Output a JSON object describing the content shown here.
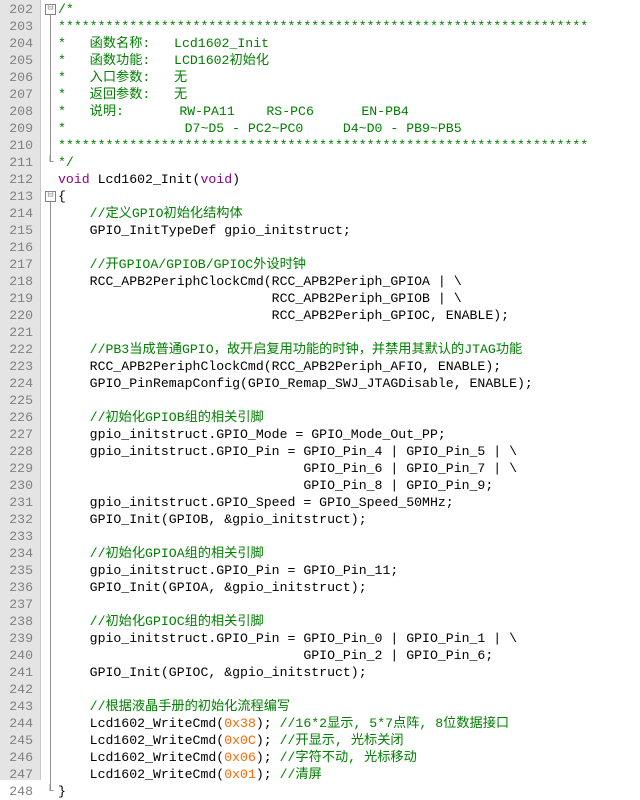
{
  "editor": {
    "colors": {
      "comment": "#008000",
      "keyword": "#8b008b",
      "number": "#ff6600",
      "text": "#000000",
      "gutter": "#e4e4e4"
    },
    "lines": [
      {
        "no": "202",
        "marker": "⊟",
        "segments": [
          {
            "t": "/*",
            "c": "cm"
          }
        ]
      },
      {
        "no": "203",
        "marker": "",
        "segments": [
          {
            "t": "*******************************************************************",
            "c": "cm"
          }
        ]
      },
      {
        "no": "204",
        "marker": "",
        "segments": [
          {
            "t": "*   函数名称:   Lcd1602_Init",
            "c": "cm"
          }
        ]
      },
      {
        "no": "205",
        "marker": "",
        "segments": [
          {
            "t": "*   函数功能:   LCD1602初始化",
            "c": "cm"
          }
        ]
      },
      {
        "no": "206",
        "marker": "",
        "segments": [
          {
            "t": "*   入口参数:   无",
            "c": "cm"
          }
        ]
      },
      {
        "no": "207",
        "marker": "",
        "segments": [
          {
            "t": "*   返回参数:   无",
            "c": "cm"
          }
        ]
      },
      {
        "no": "208",
        "marker": "",
        "segments": [
          {
            "t": "*   说明:       RW-PA11    RS-PC6      EN-PB4",
            "c": "cm"
          }
        ]
      },
      {
        "no": "209",
        "marker": "",
        "segments": [
          {
            "t": "*               D7~D5 - PC2~PC0     D4~D0 - PB9~PB5",
            "c": "cm"
          }
        ]
      },
      {
        "no": "210",
        "marker": "",
        "segments": [
          {
            "t": "*******************************************************************",
            "c": "cm"
          }
        ]
      },
      {
        "no": "211",
        "marker": "└",
        "segments": [
          {
            "t": "*/",
            "c": "cm"
          }
        ]
      },
      {
        "no": "212",
        "marker": "",
        "segments": [
          {
            "t": "void",
            "c": "kw"
          },
          {
            "t": " Lcd1602_Init(",
            "c": ""
          },
          {
            "t": "void",
            "c": "kw"
          },
          {
            "t": ")",
            "c": ""
          }
        ]
      },
      {
        "no": "213",
        "marker": "⊟",
        "segments": [
          {
            "t": "{",
            "c": ""
          }
        ]
      },
      {
        "no": "214",
        "marker": "",
        "segments": [
          {
            "t": "    //定义GPIO初始化结构体",
            "c": "cm"
          }
        ]
      },
      {
        "no": "215",
        "marker": "",
        "segments": [
          {
            "t": "    GPIO_InitTypeDef gpio_initstruct;",
            "c": ""
          }
        ]
      },
      {
        "no": "216",
        "marker": "",
        "segments": [
          {
            "t": "",
            "c": ""
          }
        ]
      },
      {
        "no": "217",
        "marker": "",
        "segments": [
          {
            "t": "    //开GPIOA/GPIOB/GPIOC外设时钟",
            "c": "cm"
          }
        ]
      },
      {
        "no": "218",
        "marker": "",
        "segments": [
          {
            "t": "    RCC_APB2PeriphClockCmd(RCC_APB2Periph_GPIOA | \\",
            "c": ""
          }
        ]
      },
      {
        "no": "219",
        "marker": "",
        "segments": [
          {
            "t": "                           RCC_APB2Periph_GPIOB | \\",
            "c": ""
          }
        ]
      },
      {
        "no": "220",
        "marker": "",
        "segments": [
          {
            "t": "                           RCC_APB2Periph_GPIOC, ENABLE);",
            "c": ""
          }
        ]
      },
      {
        "no": "221",
        "marker": "",
        "segments": [
          {
            "t": "",
            "c": ""
          }
        ]
      },
      {
        "no": "222",
        "marker": "",
        "segments": [
          {
            "t": "    //PB3当成普通GPIO，故开启复用功能的时钟，并禁用其默认的JTAG功能",
            "c": "cm"
          }
        ]
      },
      {
        "no": "223",
        "marker": "",
        "segments": [
          {
            "t": "    RCC_APB2PeriphClockCmd(RCC_APB2Periph_AFIO, ENABLE);",
            "c": ""
          }
        ]
      },
      {
        "no": "224",
        "marker": "",
        "segments": [
          {
            "t": "    GPIO_PinRemapConfig(GPIO_Remap_SWJ_JTAGDisable, ENABLE);",
            "c": ""
          }
        ]
      },
      {
        "no": "225",
        "marker": "",
        "segments": [
          {
            "t": "",
            "c": ""
          }
        ]
      },
      {
        "no": "226",
        "marker": "",
        "segments": [
          {
            "t": "    //初始化GPIOB组的相关引脚",
            "c": "cm"
          }
        ]
      },
      {
        "no": "227",
        "marker": "",
        "segments": [
          {
            "t": "    gpio_initstruct.GPIO_Mode = GPIO_Mode_Out_PP;",
            "c": ""
          }
        ]
      },
      {
        "no": "228",
        "marker": "",
        "segments": [
          {
            "t": "    gpio_initstruct.GPIO_Pin = GPIO_Pin_4 | GPIO_Pin_5 | \\",
            "c": ""
          }
        ]
      },
      {
        "no": "229",
        "marker": "",
        "segments": [
          {
            "t": "                               GPIO_Pin_6 | GPIO_Pin_7 | \\",
            "c": ""
          }
        ]
      },
      {
        "no": "230",
        "marker": "",
        "segments": [
          {
            "t": "                               GPIO_Pin_8 | GPIO_Pin_9;",
            "c": ""
          }
        ]
      },
      {
        "no": "231",
        "marker": "",
        "segments": [
          {
            "t": "    gpio_initstruct.GPIO_Speed = GPIO_Speed_50MHz;",
            "c": ""
          }
        ]
      },
      {
        "no": "232",
        "marker": "",
        "segments": [
          {
            "t": "    GPIO_Init(GPIOB, &gpio_initstruct);",
            "c": ""
          }
        ]
      },
      {
        "no": "233",
        "marker": "",
        "segments": [
          {
            "t": "",
            "c": ""
          }
        ]
      },
      {
        "no": "234",
        "marker": "",
        "segments": [
          {
            "t": "    //初始化GPIOA组的相关引脚",
            "c": "cm"
          }
        ]
      },
      {
        "no": "235",
        "marker": "",
        "segments": [
          {
            "t": "    gpio_initstruct.GPIO_Pin = GPIO_Pin_11;",
            "c": ""
          }
        ]
      },
      {
        "no": "236",
        "marker": "",
        "segments": [
          {
            "t": "    GPIO_Init(GPIOA, &gpio_initstruct);",
            "c": ""
          }
        ]
      },
      {
        "no": "237",
        "marker": "",
        "segments": [
          {
            "t": "",
            "c": ""
          }
        ]
      },
      {
        "no": "238",
        "marker": "",
        "segments": [
          {
            "t": "    //初始化GPIOC组的相关引脚",
            "c": "cm"
          }
        ]
      },
      {
        "no": "239",
        "marker": "",
        "segments": [
          {
            "t": "    gpio_initstruct.GPIO_Pin = GPIO_Pin_0 | GPIO_Pin_1 | \\",
            "c": ""
          }
        ]
      },
      {
        "no": "240",
        "marker": "",
        "segments": [
          {
            "t": "                               GPIO_Pin_2 | GPIO_Pin_6;",
            "c": ""
          }
        ]
      },
      {
        "no": "241",
        "marker": "",
        "segments": [
          {
            "t": "    GPIO_Init(GPIOC, &gpio_initstruct);",
            "c": ""
          }
        ]
      },
      {
        "no": "242",
        "marker": "",
        "segments": [
          {
            "t": "",
            "c": ""
          }
        ]
      },
      {
        "no": "243",
        "marker": "",
        "segments": [
          {
            "t": "    //根据液晶手册的初始化流程编写",
            "c": "cm"
          }
        ]
      },
      {
        "no": "244",
        "marker": "",
        "segments": [
          {
            "t": "    Lcd1602_WriteCmd(",
            "c": ""
          },
          {
            "t": "0x38",
            "c": "num"
          },
          {
            "t": "); ",
            "c": ""
          },
          {
            "t": "//16*2显示, 5*7点阵, 8位数据接口",
            "c": "cm"
          }
        ]
      },
      {
        "no": "245",
        "marker": "",
        "segments": [
          {
            "t": "    Lcd1602_WriteCmd(",
            "c": ""
          },
          {
            "t": "0x0C",
            "c": "num"
          },
          {
            "t": "); ",
            "c": ""
          },
          {
            "t": "//开显示, 光标关闭",
            "c": "cm"
          }
        ]
      },
      {
        "no": "246",
        "marker": "",
        "segments": [
          {
            "t": "    Lcd1602_WriteCmd(",
            "c": ""
          },
          {
            "t": "0x06",
            "c": "num"
          },
          {
            "t": "); ",
            "c": ""
          },
          {
            "t": "//字符不动, 光标移动",
            "c": "cm"
          }
        ]
      },
      {
        "no": "247",
        "marker": "",
        "segments": [
          {
            "t": "    Lcd1602_WriteCmd(",
            "c": ""
          },
          {
            "t": "0x01",
            "c": "num"
          },
          {
            "t": "); ",
            "c": ""
          },
          {
            "t": "//清屏",
            "c": "cm"
          }
        ]
      },
      {
        "no": "248",
        "marker": "└",
        "segments": [
          {
            "t": "}",
            "c": ""
          }
        ]
      }
    ]
  }
}
